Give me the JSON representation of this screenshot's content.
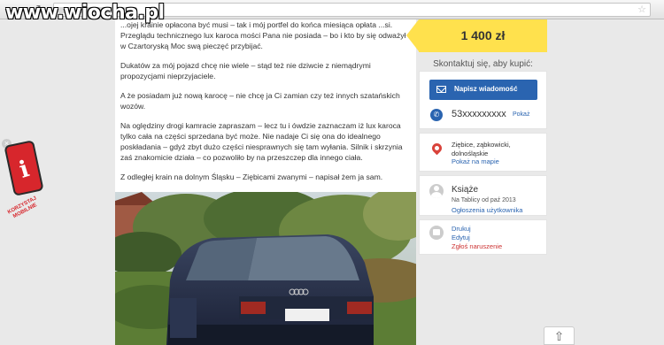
{
  "watermark": "www.wiocha.pl",
  "listing": {
    "description": [
      "...ojej krainie opłacona być musi – tak i mój portfel do końca miesiąca opłata ...si. Przeglądu technicznego lux karoca mości Pana nie posiada – bo i kto by się odważył w Czartoryską Moc swą pieczęć przybijać.",
      "Dukatów za mój pojazd chcę nie wiele – stąd też nie dziwcie z niemądrymi propozycjami nieprzyjaciele.",
      "A że posiadam już nową karocę – nie chcę ja Ci zamian czy też innych szatańskich wozów.",
      "Na oględziny drogi kamracie zapraszam – lecz tu i ówdzie zaznaczam iż lux karoca tylko cała na części sprzedana być może. Nie nadaje Ci się ona do idealnego poskładania – gdyż zbyt dużo części niesprawnych się tam wyłania. Silnik i skrzynia zaś znakomicie działa – co pozwoliło by na przeszczep dla innego ciała.",
      "Z odległej krain na dolnym Śląsku – Ziębicami zwanymi – napisał żem ja sam."
    ]
  },
  "side_widget": {
    "label": "KORZYSTAJ MOBILNIE",
    "icon": "i"
  },
  "sidebar": {
    "price": "1 400 zł",
    "contact_title": "Skontaktuj się, aby kupić:",
    "message_button": "Napisz wiadomość",
    "phone_number": "53xxxxxxxxx",
    "phone_show": "Pokaż",
    "location": "Ziębice, ząbkowicki, dolnośląskie",
    "map_link": "Pokaż na mapie",
    "user_name": "Książe",
    "user_since": "Na Tablicy od paź 2013",
    "user_ads": "Ogłoszenia użytkownika",
    "actions": [
      "Drukuj",
      "Edytuj",
      "Zgłoś naruszenie"
    ]
  },
  "colors": {
    "price_bg": "#ffe14d",
    "accent": "#2a64b0",
    "danger": "#c33"
  },
  "icons": {
    "back": "back-arrow-icon",
    "forward": "forward-arrow-icon",
    "reload": "reload-icon",
    "star": "bookmark-star-icon",
    "scroll_top": "chevron-up-icon"
  }
}
